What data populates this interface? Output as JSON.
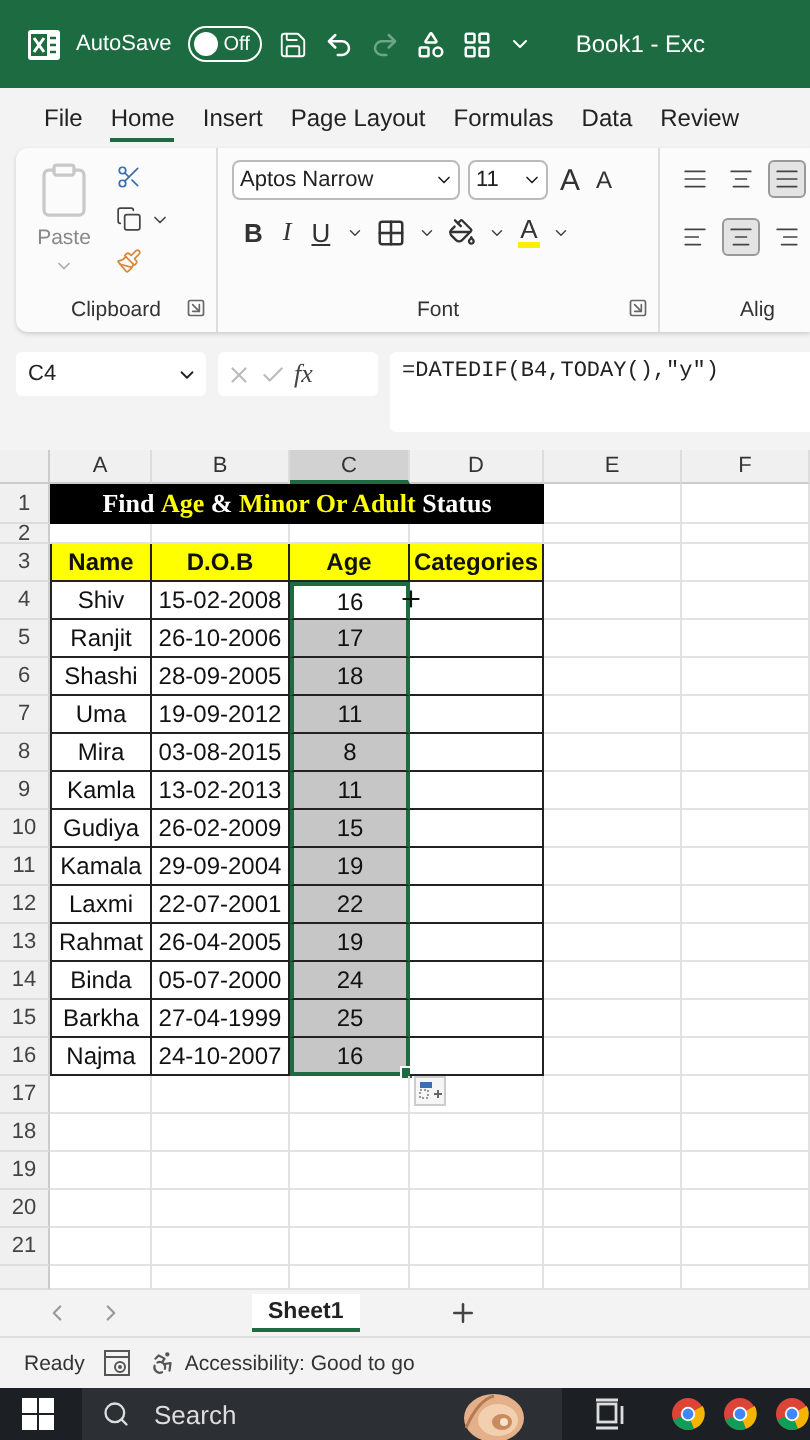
{
  "title_bar": {
    "autosave_label": "AutoSave",
    "autosave_toggle": {
      "label": "Off",
      "on": false
    },
    "document_title": "Book1 - Exc"
  },
  "menu_tabs": [
    {
      "label": "File",
      "selected": false
    },
    {
      "label": "Home",
      "selected": true
    },
    {
      "label": "Insert",
      "selected": false
    },
    {
      "label": "Page Layout",
      "selected": false
    },
    {
      "label": "Formulas",
      "selected": false
    },
    {
      "label": "Data",
      "selected": false
    },
    {
      "label": "Review",
      "selected": false
    }
  ],
  "ribbon": {
    "clipboard": {
      "paste_label": "Paste",
      "group_label": "Clipboard"
    },
    "font": {
      "font_name": "Aptos Narrow",
      "font_size": "11",
      "grow_font": "A",
      "shrink_font": "A",
      "bold": "B",
      "italic": "I",
      "underline": "U",
      "font_color": "A",
      "group_label": "Font"
    },
    "alignment": {
      "group_label": "Alig"
    }
  },
  "formula_bar": {
    "name_box": "C4",
    "function_label": "fx",
    "formula": "=DATEDIF(B4,TODAY(),\"y\")"
  },
  "sheet": {
    "columns": [
      {
        "label": "A",
        "selected": false
      },
      {
        "label": "B",
        "selected": false
      },
      {
        "label": "C",
        "selected": true
      },
      {
        "label": "D",
        "selected": false
      },
      {
        "label": "E",
        "selected": false
      },
      {
        "label": "F",
        "selected": false
      }
    ],
    "title_row": {
      "number": "1",
      "parts": [
        {
          "text": "Find ",
          "highlight": false
        },
        {
          "text": "Age",
          "highlight": true
        },
        {
          "text": " & ",
          "highlight": false
        },
        {
          "text": "Minor Or Adult",
          "highlight": true
        },
        {
          "text": " Status",
          "highlight": false
        }
      ]
    },
    "spacer_row": {
      "number": "2"
    },
    "header_row": {
      "number": "3",
      "cells": [
        "Name",
        "D.O.B",
        "Age",
        "Categories"
      ]
    },
    "data_rows": [
      {
        "number": "4",
        "name": "Shiv",
        "dob": "15-02-2008",
        "age": "16",
        "selected": false
      },
      {
        "number": "5",
        "name": "Ranjit",
        "dob": "26-10-2006",
        "age": "17",
        "selected": true
      },
      {
        "number": "6",
        "name": "Shashi",
        "dob": "28-09-2005",
        "age": "18",
        "selected": true
      },
      {
        "number": "7",
        "name": "Uma",
        "dob": "19-09-2012",
        "age": "11",
        "selected": true
      },
      {
        "number": "8",
        "name": "Mira",
        "dob": "03-08-2015",
        "age": "8",
        "selected": true
      },
      {
        "number": "9",
        "name": "Kamla",
        "dob": "13-02-2013",
        "age": "11",
        "selected": true
      },
      {
        "number": "10",
        "name": "Gudiya",
        "dob": "26-02-2009",
        "age": "15",
        "selected": true
      },
      {
        "number": "11",
        "name": "Kamala",
        "dob": "29-09-2004",
        "age": "19",
        "selected": true
      },
      {
        "number": "12",
        "name": "Laxmi",
        "dob": "22-07-2001",
        "age": "22",
        "selected": true
      },
      {
        "number": "13",
        "name": "Rahmat",
        "dob": "26-04-2005",
        "age": "19",
        "selected": true
      },
      {
        "number": "14",
        "name": "Binda",
        "dob": "05-07-2000",
        "age": "24",
        "selected": true
      },
      {
        "number": "15",
        "name": "Barkha",
        "dob": "27-04-1999",
        "age": "25",
        "selected": true
      },
      {
        "number": "16",
        "name": "Najma",
        "dob": "24-10-2007",
        "age": "16",
        "selected": true
      }
    ],
    "empty_rows": [
      "17",
      "18",
      "19",
      "20",
      "21"
    ]
  },
  "sheet_tabs": [
    {
      "label": "Sheet1",
      "selected": true
    }
  ],
  "status_bar": {
    "mode": "Ready",
    "accessibility": "Accessibility: Good to go"
  },
  "taskbar": {
    "search_placeholder": "Search"
  }
}
